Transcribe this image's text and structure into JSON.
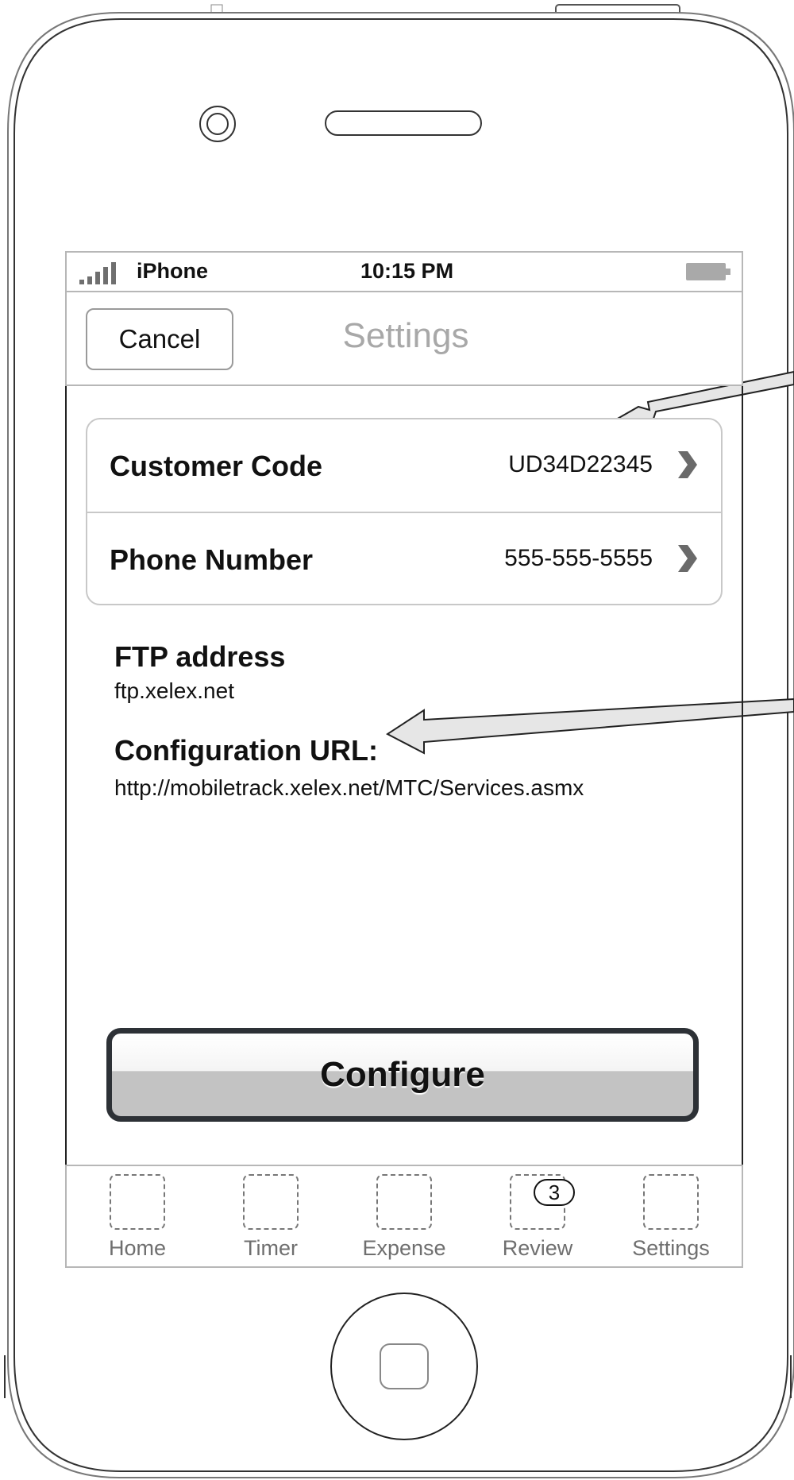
{
  "status_bar": {
    "carrier": "iPhone",
    "time": "10:15 PM"
  },
  "nav_bar": {
    "cancel_label": "Cancel",
    "title": "Settings"
  },
  "settings_table": {
    "rows": [
      {
        "label": "Customer Code",
        "value": "UD34D22345"
      },
      {
        "label": "Phone Number",
        "value": "555-555-5555"
      }
    ]
  },
  "ftp": {
    "title": "FTP address",
    "value": "ftp.xelex.net"
  },
  "config_url": {
    "title": "Configuration URL:",
    "value": "http://mobiletrack.xelex.net/MTC/Services.asmx"
  },
  "configure_button": {
    "label": "Configure"
  },
  "tab_bar": {
    "tabs": [
      {
        "label": "Home"
      },
      {
        "label": "Timer"
      },
      {
        "label": "Expense"
      },
      {
        "label": "Review",
        "badge": "3"
      },
      {
        "label": "Settings"
      }
    ]
  }
}
